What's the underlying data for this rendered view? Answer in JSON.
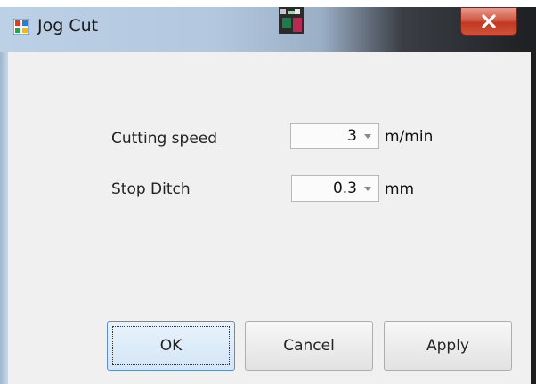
{
  "window": {
    "title": "Jog Cut",
    "close_label": "x"
  },
  "form": {
    "cutting_speed": {
      "label": "Cutting speed",
      "value": "3",
      "unit": "m/min"
    },
    "stop_ditch": {
      "label": "Stop Ditch",
      "value": "0.3",
      "unit": "mm"
    }
  },
  "buttons": {
    "ok": "OK",
    "cancel": "Cancel",
    "apply": "Apply"
  }
}
